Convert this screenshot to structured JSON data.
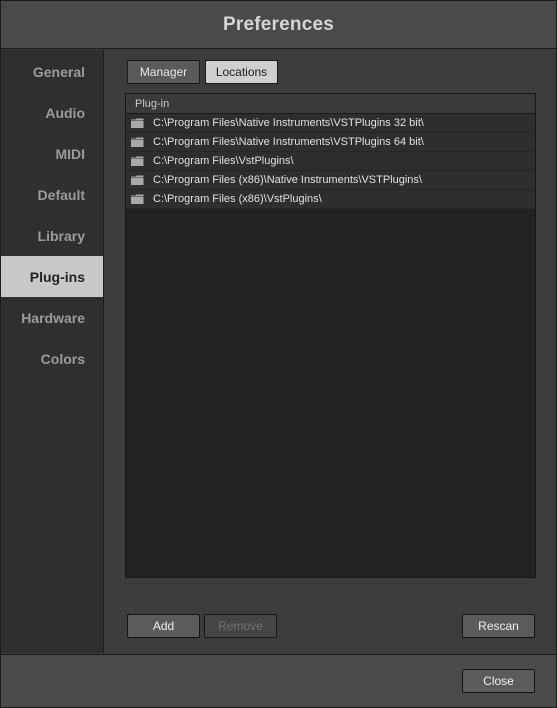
{
  "window": {
    "title": "Preferences"
  },
  "sidebar": {
    "items": [
      {
        "label": "General",
        "active": false
      },
      {
        "label": "Audio",
        "active": false
      },
      {
        "label": "MIDI",
        "active": false
      },
      {
        "label": "Default",
        "active": false
      },
      {
        "label": "Library",
        "active": false
      },
      {
        "label": "Plug-ins",
        "active": true
      },
      {
        "label": "Hardware",
        "active": false
      },
      {
        "label": "Colors",
        "active": false
      }
    ]
  },
  "tabs": {
    "manager": "Manager",
    "locations": "Locations",
    "active": "Locations"
  },
  "list": {
    "header": "Plug-in",
    "icon": "folder-icon",
    "rows": [
      "C:\\Program Files\\Native Instruments\\VSTPlugins 32 bit\\",
      "C:\\Program Files\\Native Instruments\\VSTPlugins 64 bit\\",
      "C:\\Program Files\\VstPlugins\\",
      "C:\\Program Files (x86)\\Native Instruments\\VSTPlugins\\",
      "C:\\Program Files (x86)\\VstPlugins\\"
    ]
  },
  "actions": {
    "add": "Add",
    "remove": "Remove",
    "rescan": "Rescan"
  },
  "footer": {
    "close": "Close"
  },
  "colors": {
    "active_sidebar_bg": "#c9c9c9",
    "panel_bg": "#222222",
    "button_bg": "#5b5b5b"
  }
}
